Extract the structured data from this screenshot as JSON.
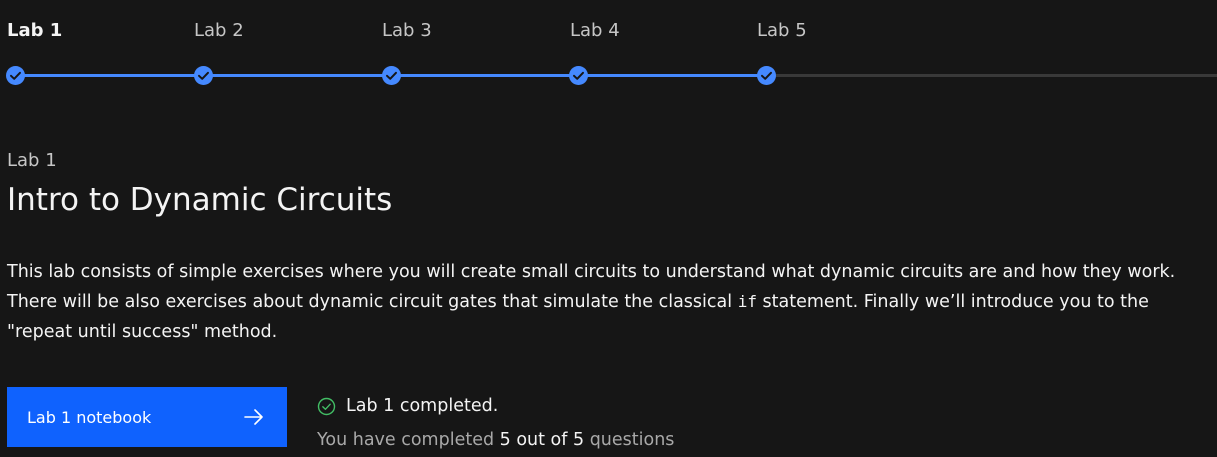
{
  "stepper": {
    "steps": [
      {
        "label": "Lab 1",
        "state": "complete",
        "current": true
      },
      {
        "label": "Lab 2",
        "state": "complete",
        "current": false
      },
      {
        "label": "Lab 3",
        "state": "complete",
        "current": false
      },
      {
        "label": "Lab 4",
        "state": "complete",
        "current": false
      },
      {
        "label": "Lab 5",
        "state": "complete",
        "current": false
      }
    ],
    "icon": "checkmark-circle-icon",
    "completed_color": "#4589ff",
    "pending_color": "#393939"
  },
  "lab": {
    "eyebrow": "Lab 1",
    "title": "Intro to Dynamic Circuits",
    "description_before_code": "This lab consists of simple exercises where you will create small circuits to understand what dynamic circuits are and how they work. There will be also exercises about dynamic circuit gates that simulate the classical ",
    "description_code": "if",
    "description_after_code": " statement. Finally we’ll introduce you to the \"repeat until success\" method."
  },
  "actions": {
    "notebook_button_label": "Lab 1 notebook",
    "notebook_button_icon": "arrow-right-icon",
    "button_color": "#0f62fe"
  },
  "status": {
    "icon": "checkmark-outline-icon",
    "icon_color": "#42be65",
    "completed_label": "Lab 1 completed.",
    "progress_prefix": "You have completed ",
    "progress_count": "5 out of 5",
    "progress_suffix": " questions"
  }
}
